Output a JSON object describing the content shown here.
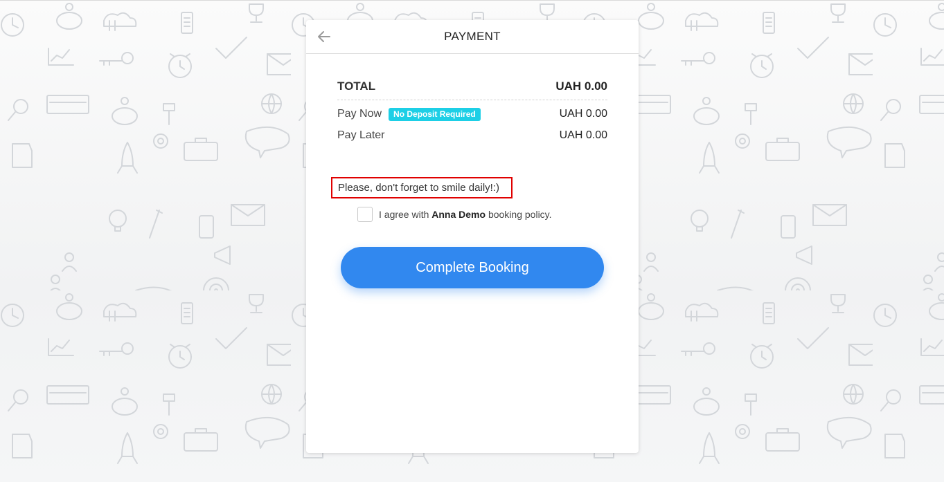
{
  "header": {
    "title": "PAYMENT",
    "back_icon": "arrow-left-icon"
  },
  "summary": {
    "total_label": "TOTAL",
    "total_value": "UAH 0.00",
    "pay_now_label": "Pay Now",
    "pay_now_badge": "No Deposit Required",
    "pay_now_value": "UAH 0.00",
    "pay_later_label": "Pay Later",
    "pay_later_value": "UAH 0.00"
  },
  "note": {
    "text": "Please, don't forget to smile daily!:)"
  },
  "agreement": {
    "prefix": "I agree with",
    "business_name": "Anna Demo",
    "suffix": "booking policy."
  },
  "actions": {
    "complete_label": "Complete Booking"
  },
  "colors": {
    "accent": "#3188ef",
    "badge": "#1dcfe6",
    "highlight_border": "#e00000"
  }
}
